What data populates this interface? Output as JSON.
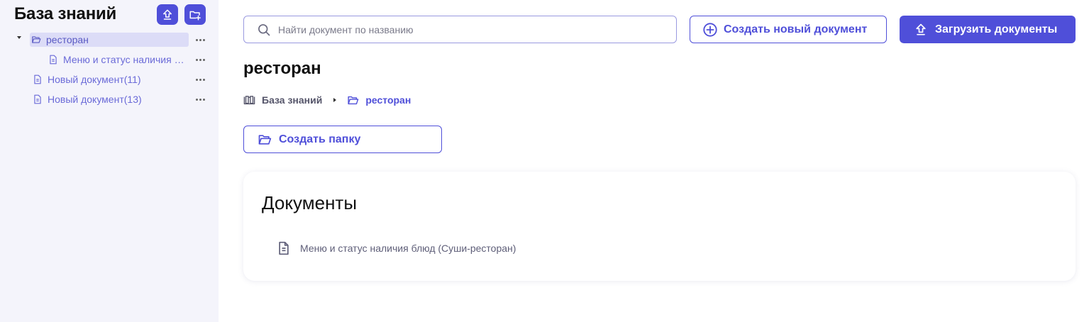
{
  "sidebar": {
    "title": "База знаний",
    "tree": [
      {
        "label": "ресторан",
        "type": "folder",
        "selected": true,
        "expanded": true
      },
      {
        "label": "Меню и статус наличия блюд (Суши-ресторан)",
        "type": "document",
        "level": 1
      },
      {
        "label": "Новый документ(11)",
        "type": "document",
        "level": 0
      },
      {
        "label": "Новый документ(13)",
        "type": "document",
        "level": 0
      }
    ]
  },
  "toolbar": {
    "search_placeholder": "Найти документ по названию",
    "create_doc_label": "Создать новый документ",
    "upload_label": "Загрузить документы"
  },
  "main": {
    "title": "ресторан",
    "breadcrumb": [
      {
        "label": "База знаний",
        "icon": "book-icon"
      },
      {
        "label": "ресторан",
        "icon": "folder-icon"
      }
    ],
    "create_folder_label": "Создать папку",
    "documents_heading": "Документы",
    "documents": [
      {
        "label": "Меню и статус наличия блюд (Суши-ресторан)"
      }
    ]
  },
  "colors": {
    "accent": "#4f4fd9",
    "sidebar_bg": "#f4f4fb",
    "selected_bg": "#dcdcf7"
  }
}
